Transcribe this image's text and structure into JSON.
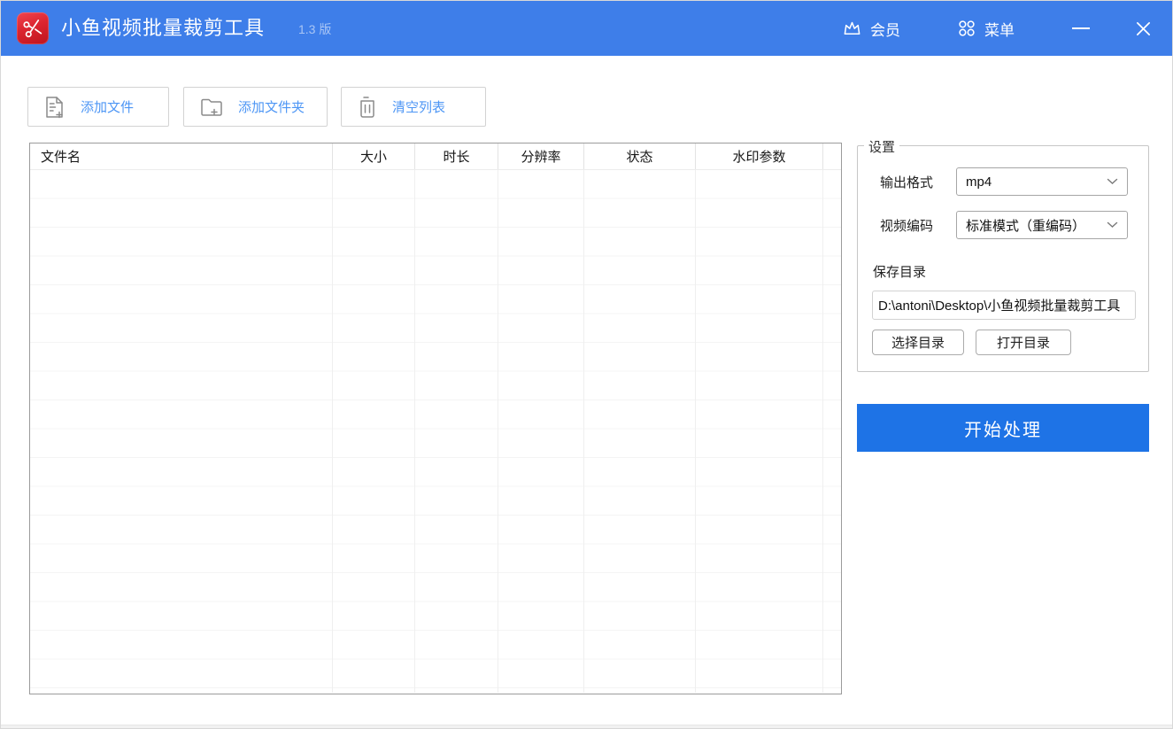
{
  "titlebar": {
    "app_title": "小鱼视频批量裁剪工具",
    "version": "1.3 版",
    "member_label": "会员",
    "menu_label": "菜单"
  },
  "toolbar": {
    "add_file": "添加文件",
    "add_folder": "添加文件夹",
    "clear_list": "清空列表"
  },
  "file_table": {
    "columns": [
      "文件名",
      "大小",
      "时长",
      "分辨率",
      "状态",
      "水印参数"
    ],
    "rows": []
  },
  "settings": {
    "group_title": "设置",
    "output_format": {
      "label": "输出格式",
      "value": "mp4"
    },
    "video_codec": {
      "label": "视频编码",
      "value": "标准模式（重编码）"
    },
    "save_dir": {
      "label": "保存目录",
      "value": "D:\\antoni\\Desktop\\小鱼视频批量裁剪工具"
    },
    "choose_dir_button": "选择目录",
    "open_dir_button": "打开目录"
  },
  "actions": {
    "start_button": "开始处理"
  },
  "icons": {
    "logo": "scissors-icon",
    "member": "crown-icon",
    "menu": "grid-dots-icon",
    "add_file": "file-plus-icon",
    "add_folder": "folder-plus-icon",
    "clear_list": "trash-icon"
  },
  "colors": {
    "titlebar_blue": "#3E7EE9",
    "accent_blue": "#4D96F5",
    "start_button_blue": "#1E73E6",
    "logo_red": "#DC2530"
  }
}
